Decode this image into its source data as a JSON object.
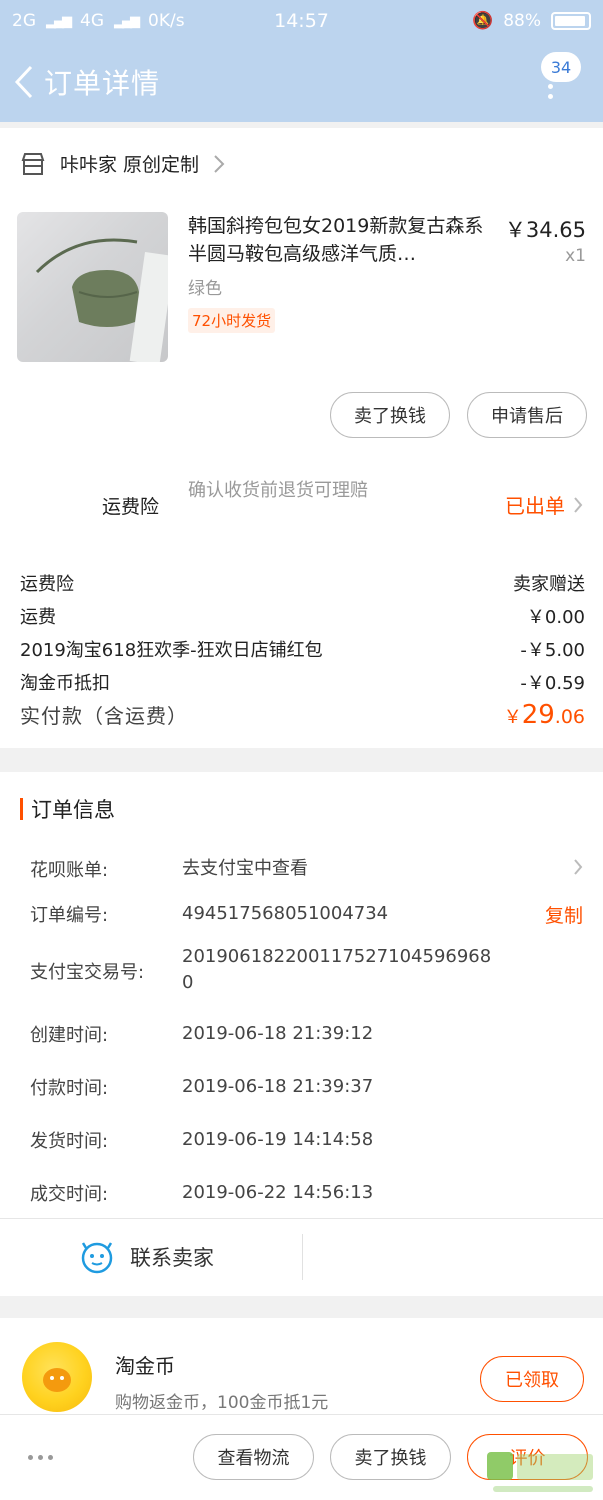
{
  "status_bar": {
    "signal_left": "2G",
    "signal_mid": "4G",
    "network_speed": "0K/s",
    "time": "14:57",
    "battery": "88%"
  },
  "nav": {
    "title": "订单详情",
    "badge_count": "34"
  },
  "shop": {
    "name": "咔咔家 原创定制"
  },
  "product": {
    "title": "韩国斜挎包包女2019新款复古森系半圆马鞍包高级感洋气质…",
    "price": "￥34.65",
    "quantity": "x1",
    "sku": "绿色",
    "ship_tag": "72小时发货"
  },
  "item_actions": {
    "sell_label": "卖了换钱",
    "after_sale_label": "申请售后"
  },
  "insurance": {
    "label": "运费险",
    "description": "确认收货前退货可理赔",
    "status": "已出单"
  },
  "fees": [
    {
      "label": "运费险",
      "value": "卖家赠送"
    },
    {
      "label": "运费",
      "value": "￥0.00"
    },
    {
      "label": "2019淘宝618狂欢季-狂欢日店铺红包",
      "value": "-￥5.00"
    },
    {
      "label": "淘金币抵扣",
      "value": "-￥0.59"
    }
  ],
  "paid": {
    "label": "实付款（含运费）",
    "currency": "￥",
    "integer": "29",
    "decimal": ".06"
  },
  "order_info": {
    "title": "订单信息",
    "huabei_label": "花呗账单:",
    "huabei_value": "去支付宝中查看",
    "order_no_label": "订单编号:",
    "order_no": "494517568051004734",
    "copy_label": "复制",
    "alipay_label": "支付宝交易号:",
    "alipay_no": "2019061822001175271045969680",
    "created_label": "创建时间:",
    "created": "2019-06-18 21:39:12",
    "paid_label": "付款时间:",
    "paid_time": "2019-06-18 21:39:37",
    "shipped_label": "发货时间:",
    "shipped": "2019-06-19 14:14:58",
    "closed_label": "成交时间:",
    "closed": "2019-06-22 14:56:13"
  },
  "contact": {
    "label": "联系卖家"
  },
  "coin": {
    "title": "淘金币",
    "description": "购物返金币，100金币抵1元",
    "button": "已领取"
  },
  "bottom_actions": {
    "logistics": "查看物流",
    "sell": "卖了换钱",
    "review": "评价"
  },
  "colors": {
    "accent": "#ff5000",
    "nav_bg": "#bcd4ee"
  }
}
